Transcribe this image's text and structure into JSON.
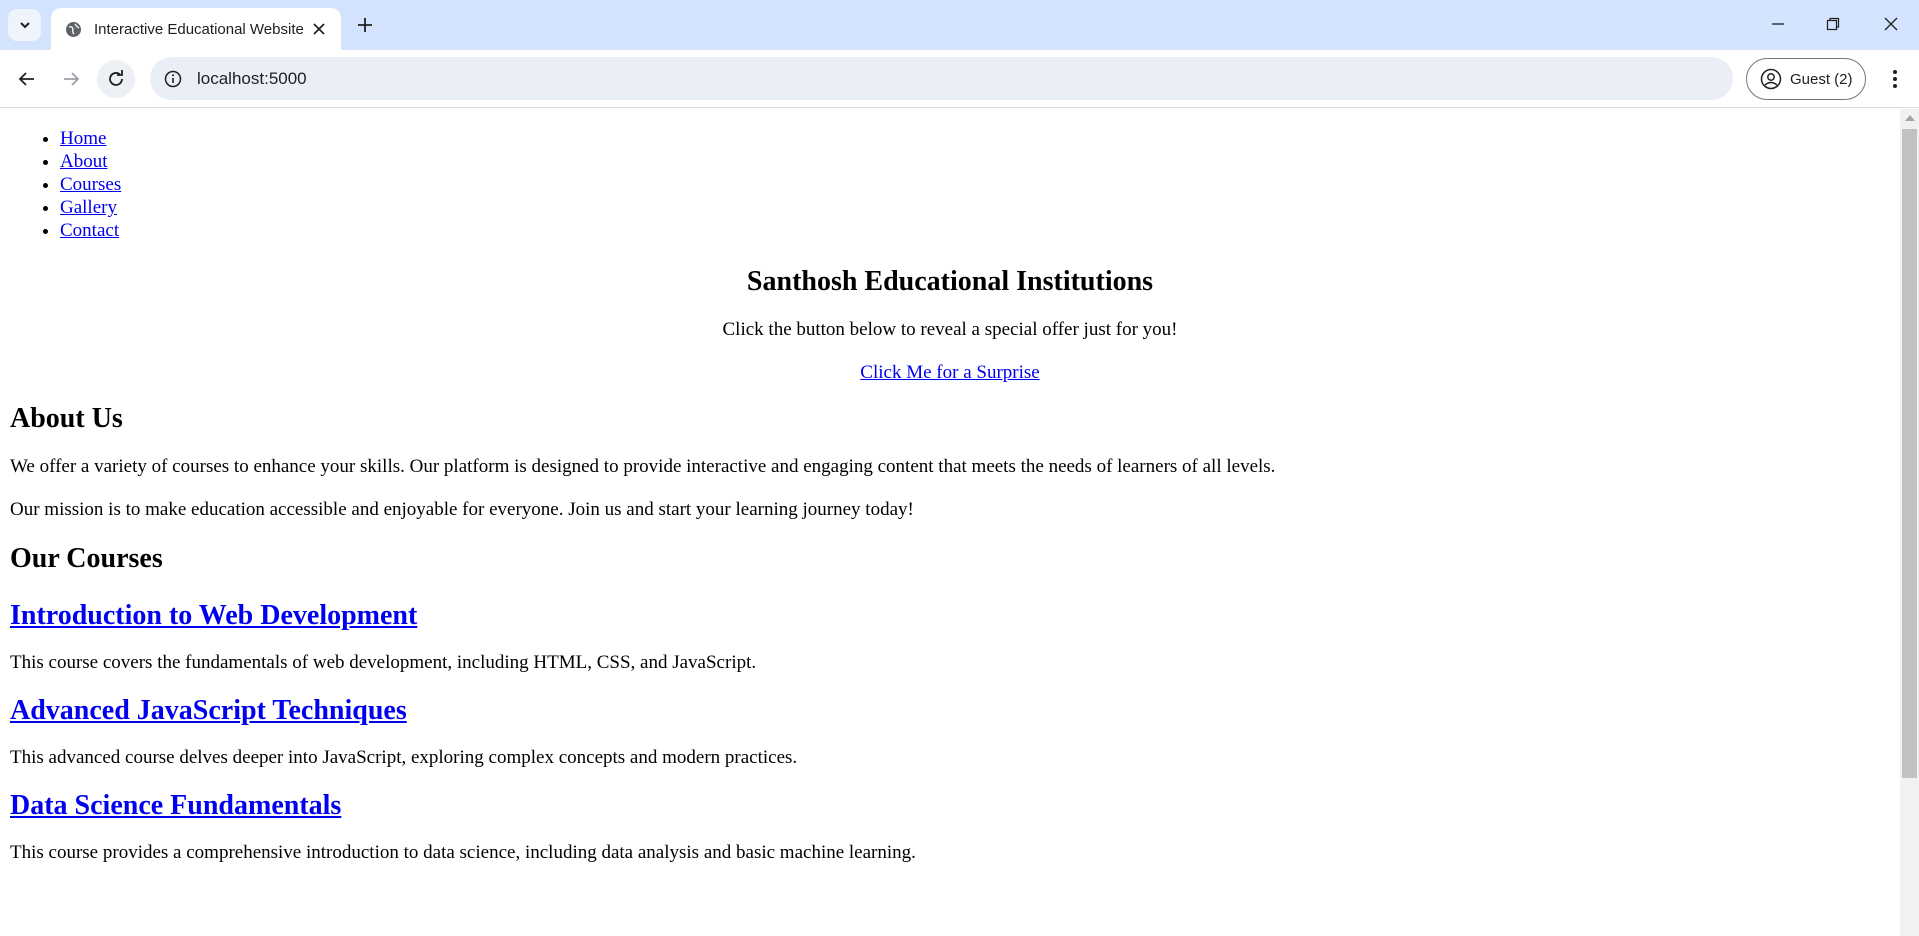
{
  "browser": {
    "tab_title": "Interactive Educational Website",
    "url": "localhost:5000",
    "profile_label": "Guest (2)",
    "icons": [
      "chevron-down-icon",
      "globe-icon",
      "close-icon",
      "plus-icon",
      "minimize-icon",
      "restore-icon",
      "close-window-icon",
      "back-icon",
      "forward-icon",
      "reload-icon",
      "info-icon",
      "profile-icon",
      "kebab-menu-icon"
    ]
  },
  "page": {
    "nav": [
      "Home",
      "About",
      "Courses",
      "Gallery",
      "Contact"
    ],
    "hero": {
      "title": "Santhosh Educational Institutions",
      "subtitle": "Click the button below to reveal a special offer just for you!",
      "cta": "Click Me for a Surprise"
    },
    "about": {
      "heading": "About Us",
      "p1": "We offer a variety of courses to enhance your skills. Our platform is designed to provide interactive and engaging content that meets the needs of learners of all levels.",
      "p2": "Our mission is to make education accessible and enjoyable for everyone. Join us and start your learning journey today!"
    },
    "courses": {
      "heading": "Our Courses",
      "items": [
        {
          "title": "Introduction to Web Development",
          "desc": "This course covers the fundamentals of web development, including HTML, CSS, and JavaScript."
        },
        {
          "title": "Advanced JavaScript Techniques",
          "desc": "This advanced course delves deeper into JavaScript, exploring complex concepts and modern practices."
        },
        {
          "title": "Data Science Fundamentals",
          "desc": "This course provides a comprehensive introduction to data science, including data analysis and basic machine learning."
        }
      ]
    }
  },
  "colors": {
    "link": "#0000ee",
    "tabstrip": "#d3e3fd",
    "omnibox": "#eaeef6"
  }
}
